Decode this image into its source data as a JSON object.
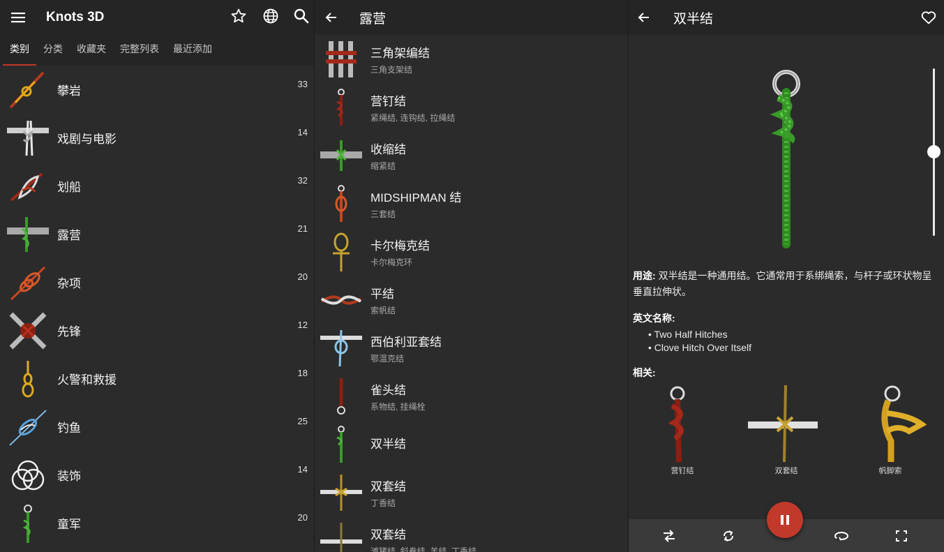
{
  "left": {
    "app_title": "Knots 3D",
    "tabs": [
      "类别",
      "分类",
      "收藏夹",
      "完整列表",
      "最近添加"
    ],
    "categories": [
      {
        "label": "攀岩",
        "count": "33"
      },
      {
        "label": "戏剧与电影",
        "count": "14"
      },
      {
        "label": "划船",
        "count": "32"
      },
      {
        "label": "露营",
        "count": "21"
      },
      {
        "label": "杂项",
        "count": "20"
      },
      {
        "label": "先锋",
        "count": "12"
      },
      {
        "label": "火警和救援",
        "count": "18"
      },
      {
        "label": "钓鱼",
        "count": "25"
      },
      {
        "label": "装饰",
        "count": "14"
      },
      {
        "label": "童军",
        "count": "20"
      }
    ]
  },
  "middle": {
    "title": "露营",
    "knots": [
      {
        "name": "三角架编结",
        "sub": "三角支架结"
      },
      {
        "name": "营钉结",
        "sub": "紧绳结, 连钩结, 拉绳结"
      },
      {
        "name": "收缩结",
        "sub": "缩紧结"
      },
      {
        "name": "MIDSHIPMAN 结",
        "sub": "三套结"
      },
      {
        "name": "卡尔梅克结",
        "sub": "卡尔梅克环"
      },
      {
        "name": "平结",
        "sub": "索帆结"
      },
      {
        "name": "西伯利亚套结",
        "sub": "鄂温克结"
      },
      {
        "name": "雀头结",
        "sub": "系物结, 挂绳栓"
      },
      {
        "name": "双半结",
        "sub": ""
      },
      {
        "name": "双套结",
        "sub": "丁香结"
      },
      {
        "name": "双套结",
        "sub": "滩猪结, 斜卷结, 羊结, 丁香结"
      }
    ]
  },
  "right": {
    "title": "双半结",
    "usage_label": "用途:",
    "usage_text": "双半结是一种通用结。它通常用于系绑绳索，与杆子或环状物呈垂直拉伸状。",
    "english_label": "英文名称:",
    "english_names": [
      "• Two Half Hitches",
      "• Clove Hitch Over Itself"
    ],
    "related_label": "相关:",
    "related": [
      "营钉结",
      "双套结",
      "帆脚索"
    ]
  },
  "colors": {
    "accent": "#c0392b",
    "bar": "#252525",
    "bg": "#2b2b2b",
    "bottom_bar": "#3a3a3a"
  },
  "icons": {
    "left_bar": [
      "menu-icon",
      "star-icon",
      "globe-icon",
      "search-icon"
    ],
    "mid_bar": [
      "back-arrow-icon"
    ],
    "right_bar": [
      "search-icon",
      "back-arrow-icon",
      "heart-icon"
    ],
    "bottom_bar": [
      "swap-icon",
      "repeat-icon",
      "rotate-icon",
      "pause-icon",
      "fullscreen-icon"
    ]
  }
}
